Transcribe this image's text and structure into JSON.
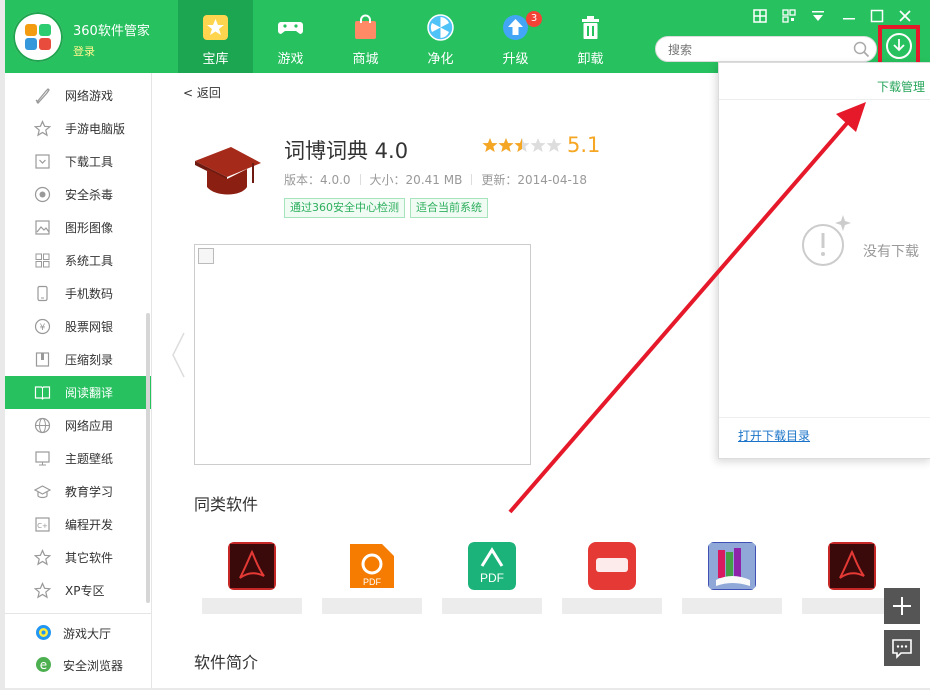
{
  "app": {
    "name": "360软件管家",
    "login": "登录"
  },
  "nav": [
    {
      "label": "宝库",
      "icon": "star-icon",
      "active": true
    },
    {
      "label": "游戏",
      "icon": "gamepad-icon"
    },
    {
      "label": "商城",
      "icon": "shopping-bag-icon"
    },
    {
      "label": "净化",
      "icon": "fan-icon"
    },
    {
      "label": "升级",
      "icon": "upgrade-arrow-icon",
      "badge": "3"
    },
    {
      "label": "卸载",
      "icon": "trash-icon"
    }
  ],
  "search": {
    "placeholder": "搜索"
  },
  "sidebar": {
    "items": [
      {
        "label": "网络游戏",
        "icon": "sword-icon"
      },
      {
        "label": "手游电脑版",
        "icon": "star-outline-icon"
      },
      {
        "label": "下载工具",
        "icon": "download-tray-icon"
      },
      {
        "label": "安全杀毒",
        "icon": "shield-circle-icon"
      },
      {
        "label": "图形图像",
        "icon": "image-icon"
      },
      {
        "label": "系统工具",
        "icon": "grid-icon"
      },
      {
        "label": "手机数码",
        "icon": "phone-icon"
      },
      {
        "label": "股票网银",
        "icon": "yen-icon"
      },
      {
        "label": "压缩刻录",
        "icon": "archive-icon"
      },
      {
        "label": "阅读翻译",
        "icon": "book-icon",
        "active": true
      },
      {
        "label": "网络应用",
        "icon": "globe-icon"
      },
      {
        "label": "主题壁纸",
        "icon": "wallpaper-icon"
      },
      {
        "label": "教育学习",
        "icon": "graduation-cap-icon"
      },
      {
        "label": "编程开发",
        "icon": "code-icon"
      },
      {
        "label": "其它软件",
        "icon": "star-outline-icon"
      },
      {
        "label": "XP专区",
        "icon": "star-outline-icon"
      }
    ],
    "bottom": [
      {
        "label": "游戏大厅",
        "icon": "game-hall-icon"
      },
      {
        "label": "安全浏览器",
        "icon": "browser-e-icon"
      }
    ]
  },
  "main": {
    "back": "< 返回",
    "title": "词博词典 4.0",
    "rating_value": 2.5,
    "score": "5.1",
    "meta": {
      "version": "版本：4.0.0",
      "size": "大小：20.41 MB",
      "updated": "更新：2014-04-18"
    },
    "tags": [
      "通过360安全中心检测",
      "适合当前系统"
    ],
    "similar_title": "同类软件",
    "intro_title": "软件简介",
    "similar": [
      {
        "icon": "acrobat-icon",
        "name": ""
      },
      {
        "icon": "foxit-pdf-icon",
        "name": ""
      },
      {
        "icon": "pdf-green-icon",
        "name": ""
      },
      {
        "icon": "youdao-icon",
        "name": ""
      },
      {
        "icon": "books-icon",
        "name": ""
      },
      {
        "icon": "acrobat-icon",
        "name": ""
      }
    ]
  },
  "download_panel": {
    "title": "下载管理",
    "empty_text": "没有下载",
    "open_dir": "打开下载目录"
  },
  "colors": {
    "brand_green": "#27c15f",
    "dark_green": "#1da651",
    "highlight_red": "#e6192b",
    "score_orange": "#f5a623"
  }
}
